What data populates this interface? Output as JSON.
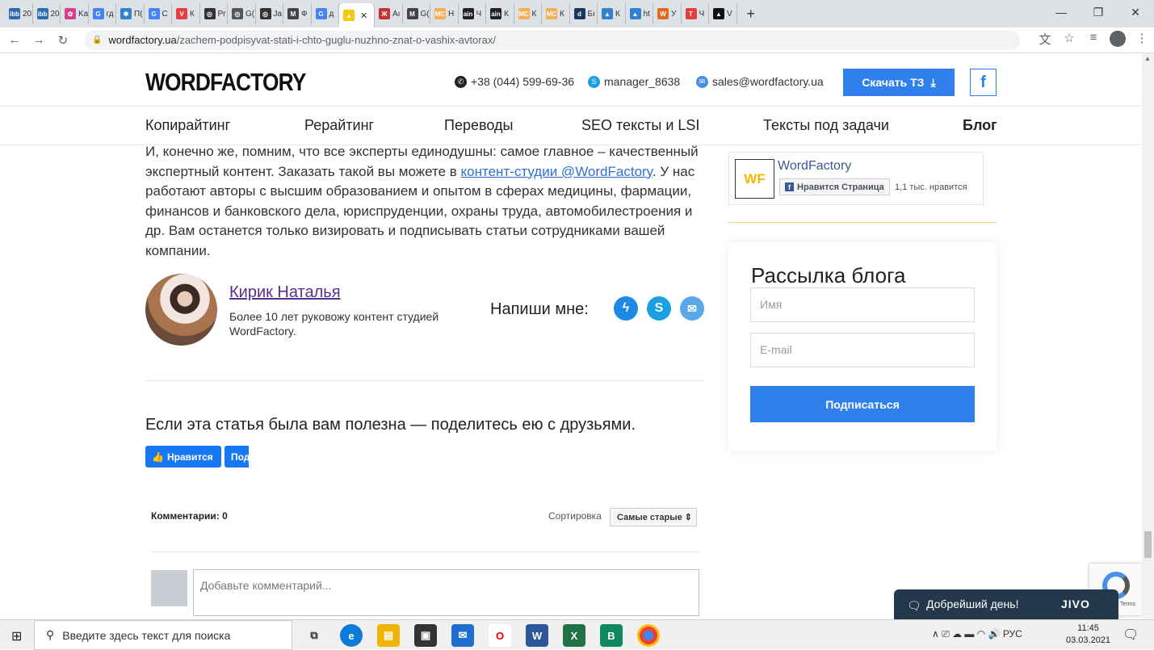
{
  "browser": {
    "tabs": [
      {
        "label": "20",
        "color": "#2b6cb0",
        "glyph": "ibb"
      },
      {
        "label": "20",
        "color": "#2b6cb0",
        "glyph": "ibb"
      },
      {
        "label": "Ka",
        "color": "#d53f8c",
        "glyph": "✿"
      },
      {
        "label": "гд",
        "color": "#4285f4",
        "glyph": "G"
      },
      {
        "label": "П(",
        "color": "#3182ce",
        "glyph": "✱"
      },
      {
        "label": "С",
        "color": "#4285f4",
        "glyph": "G"
      },
      {
        "label": "К",
        "color": "#e53e3e",
        "glyph": "V"
      },
      {
        "label": "Рr",
        "color": "#333",
        "glyph": "◎"
      },
      {
        "label": "G(",
        "color": "#555",
        "glyph": "◎"
      },
      {
        "label": "Ja",
        "color": "#333",
        "glyph": "◎"
      },
      {
        "label": "Ф",
        "color": "#444",
        "glyph": "M"
      },
      {
        "label": "д",
        "color": "#4285f4",
        "glyph": "G"
      },
      {
        "label": "",
        "color": "#f6c90e",
        "glyph": "▲",
        "active": true
      },
      {
        "label": "Аı",
        "color": "#c53030",
        "glyph": "Ж"
      },
      {
        "label": "G(",
        "color": "#444",
        "glyph": "M"
      },
      {
        "label": "Н",
        "color": "#f6ad55",
        "glyph": "MC"
      },
      {
        "label": "Ч",
        "color": "#222",
        "glyph": "ain"
      },
      {
        "label": "К",
        "color": "#222",
        "glyph": "ain"
      },
      {
        "label": "К",
        "color": "#f6ad55",
        "glyph": "MC"
      },
      {
        "label": "К",
        "color": "#f6ad55",
        "glyph": "MC"
      },
      {
        "label": "Бı",
        "color": "#1a365d",
        "glyph": "d"
      },
      {
        "label": "К",
        "color": "#3182ce",
        "glyph": "▲"
      },
      {
        "label": "ht",
        "color": "#3182ce",
        "glyph": "▲"
      },
      {
        "label": "У",
        "color": "#dd6b20",
        "glyph": "W"
      },
      {
        "label": "Ч",
        "color": "#e53e3e",
        "glyph": "T"
      },
      {
        "label": "V",
        "color": "#111",
        "glyph": "▲"
      }
    ],
    "new_tab": "+",
    "url_domain": "wordfactory.ua",
    "url_path": "/zachem-podpisyvat-stati-i-chto-guglu-nuzhno-znat-o-vashix-avtorax/"
  },
  "header": {
    "logo": "WORDFACTORY",
    "phone": "+38 (044) 599-69-36",
    "skype": "manager_8638",
    "email": "sales@wordfactory.ua",
    "download_label": "Скачать ТЗ",
    "fb_label": "f"
  },
  "menu": [
    "Копирайтинг",
    "Рерайтинг",
    "Переводы",
    "SEO тексты и LSI",
    "Тексты под задачи",
    "Блог"
  ],
  "article": {
    "p1": "И, конечно же, помним, что все эксперты единодушны: самое главное – качественный экспертный контент. Заказать такой вы можете в ",
    "link": "контент-студии @WordFactory",
    "p2": ". У нас работают авторы с высшим образованием и опытом в сферах медицины, фармации, финансов и банковского дела, юриспруденции, охраны труда, автомобилестроения и др. Вам останется только визировать и подписывать статьи сотрудниками вашей компании."
  },
  "author": {
    "name": "Кирик Наталья",
    "desc": "Более 10 лет руковожу контент студией WordFactory.",
    "write_me": "Напиши мне:"
  },
  "share": {
    "title": "Если эта статья была вам полезна — поделитесь ею с друзьями.",
    "like": "Нравится",
    "share_cut": "Под"
  },
  "comments": {
    "count_label": "Комментарии: 0",
    "sort_label": "Сортировка",
    "sort_value": "Самые старые ⇕",
    "placeholder": "Добавьте комментарий..."
  },
  "sidebar": {
    "fb_page": "WordFactory",
    "fb_logo": "WF",
    "fb_like": "Нравится Страница",
    "fb_count": "1,1 тыс. нравится",
    "newsletter_title": "Рассылка блога",
    "name_placeholder": "Имя",
    "email_placeholder": "E-mail",
    "subscribe": "Подписаться"
  },
  "recaptcha_terms": "Terms",
  "jivo": {
    "greeting": "Добрейший день!",
    "brand": "JIVO"
  },
  "taskbar": {
    "search": "Введите здесь текст для поиска",
    "lang": "РУС",
    "time": "11:45",
    "date": "03.03.2021"
  }
}
